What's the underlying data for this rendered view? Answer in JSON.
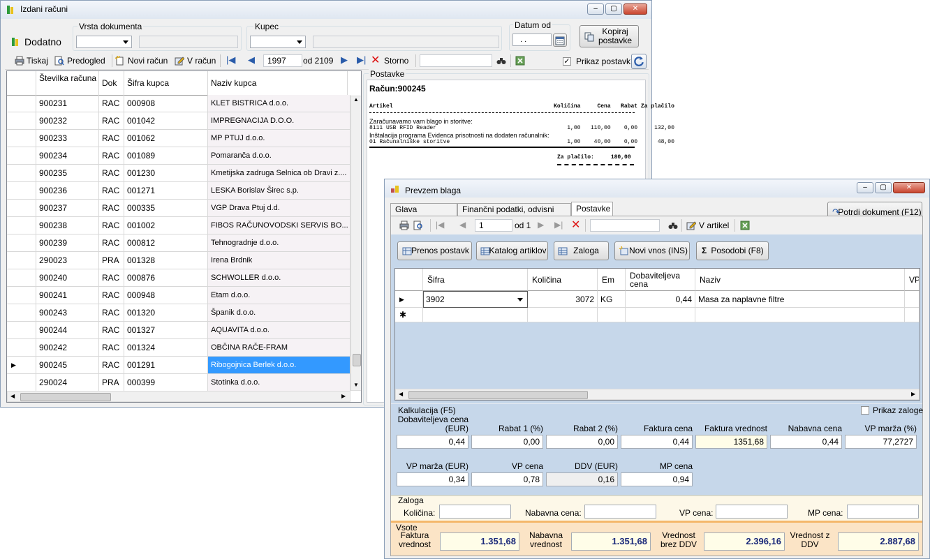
{
  "main_window": {
    "title": "Izdani računi",
    "dodatno": "Dodatno",
    "vrsta_label": "Vrsta dokumenta",
    "kupec_label": "Kupec",
    "datum_label": "Datum od",
    "datum_value": " .  .",
    "kopiraj": "Kopiraj postavke",
    "toolbar": {
      "tiskaj": "Tiskaj",
      "predogled": "Predogled",
      "novi_racun": "Novi račun",
      "v_racun": "V račun",
      "record": "1997",
      "of_total": "od 2109",
      "storno": "Storno",
      "prikaz_postavk": "Prikaz postavk"
    },
    "columns": [
      "Številka računa",
      "Dok",
      "Šifra kupca",
      "Naziv kupca"
    ],
    "rows": [
      {
        "num": "900231",
        "dok": "RAC",
        "sifra": "000908",
        "naziv": "KLET BISTRICA d.o.o."
      },
      {
        "num": "900232",
        "dok": "RAC",
        "sifra": "001042",
        "naziv": "IMPREGNACIJA D.O.O."
      },
      {
        "num": "900233",
        "dok": "RAC",
        "sifra": "001062",
        "naziv": "MP PTUJ d.o.o."
      },
      {
        "num": "900234",
        "dok": "RAC",
        "sifra": "001089",
        "naziv": "Pomaranča d.o.o."
      },
      {
        "num": "900235",
        "dok": "RAC",
        "sifra": "001230",
        "naziv": "Kmetijska zadruga Selnica ob Dravi z...."
      },
      {
        "num": "900236",
        "dok": "RAC",
        "sifra": "001271",
        "naziv": "LESKA Borislav Širec s.p."
      },
      {
        "num": "900237",
        "dok": "RAC",
        "sifra": "000335",
        "naziv": "VGP Drava Ptuj d.d."
      },
      {
        "num": "900238",
        "dok": "RAC",
        "sifra": "001002",
        "naziv": "FIBOS RAČUNOVODSKI SERVIS BO..."
      },
      {
        "num": "900239",
        "dok": "RAC",
        "sifra": "000812",
        "naziv": "Tehnogradnje d.o.o."
      },
      {
        "num": "290023",
        "dok": "PRA",
        "sifra": "001328",
        "naziv": "Irena Brdnik"
      },
      {
        "num": "900240",
        "dok": "RAC",
        "sifra": "000876",
        "naziv": "SCHWOLLER d.o.o."
      },
      {
        "num": "900241",
        "dok": "RAC",
        "sifra": "000948",
        "naziv": "Etam d.o.o."
      },
      {
        "num": "900243",
        "dok": "RAC",
        "sifra": "001320",
        "naziv": "Španik d.o.o."
      },
      {
        "num": "900244",
        "dok": "RAC",
        "sifra": "001327",
        "naziv": "AQUAVITA d.o.o."
      },
      {
        "num": "900242",
        "dok": "RAC",
        "sifra": "001324",
        "naziv": "OBČINA RAČE-FRAM"
      },
      {
        "num": "900245",
        "dok": "RAC",
        "sifra": "001291",
        "naziv": "Ribogojnica Berlek d.o.o."
      },
      {
        "num": "290024",
        "dok": "PRA",
        "sifra": "000399",
        "naziv": "Stotinka d.o.o."
      }
    ],
    "postavke_label": "Postavke",
    "preview": {
      "title": "Račun:900245",
      "header": "Artikel                                                Količina     Cena   Rabat Za plačilo",
      "lines": [
        "Zaračunavamo vam blago in storitve:",
        "8111 USB RFID Reader                                       1,00   110,00    0,00     132,00",
        "Inštalacija programa Evidenca prisotnosti na dodaten računalnik:",
        "01 Računalniške storitve                                   1,00    40,00    0,00      48,00"
      ],
      "total": "Za plačilo:     180,00"
    }
  },
  "prevzem_window": {
    "title": "Prevzem blaga",
    "tabs": [
      "Glava dokumenta",
      "Finančni podatki, odvisni stroški",
      "Postavke"
    ],
    "potrdi": "Potrdi dokument (F12)",
    "toolbar": {
      "record": "1",
      "of_total": "od 1",
      "v_artikel": "V artikel"
    },
    "actions": [
      "Prenos postavk",
      "Katalog artiklov",
      "Zaloga",
      "Novi vnos (INS)",
      "Posodobi (F8)"
    ],
    "columns": [
      "Šifra",
      "Količina",
      "Em",
      "Dobaviteljeva cena",
      "Naziv",
      "VP c"
    ],
    "row": {
      "sifra": "3902",
      "kolicina": "3072",
      "em": "KG",
      "cena": "0,44",
      "naziv": "Masa za naplavne filtre"
    },
    "kalkulacija": {
      "title": "Kalkulacija  (F5)",
      "prikaz_zaloge": "Prikaz zaloge",
      "row1_labels": [
        "Dobaviteljeva cena (EUR)",
        "Rabat 1 (%)",
        "Rabat 2 (%)",
        "Faktura cena",
        "Faktura vrednost",
        "Nabavna cena",
        "VP marža (%)"
      ],
      "row1_values": [
        "0,44",
        "0,00",
        "0,00",
        "0,44",
        "1351,68",
        "0,44",
        "77,2727"
      ],
      "row2_labels": [
        "VP marža (EUR)",
        "VP cena",
        "DDV (EUR)",
        "MP cena"
      ],
      "row2_values": [
        "0,34",
        "0,78",
        "0,16",
        "0,94"
      ]
    },
    "zaloga": {
      "title": "Zaloga",
      "labels": [
        "Količina:",
        "Nabavna cena:",
        "VP cena:",
        "MP cena:"
      ]
    },
    "vsote": {
      "title": "Vsote",
      "labels": [
        "Faktura vrednost",
        "Nabavna vrednost",
        "Vrednost brez DDV",
        "Vrednost z DDV"
      ],
      "values": [
        "1.351,68",
        "1.351,68",
        "2.396,16",
        "2.887,68"
      ]
    }
  }
}
